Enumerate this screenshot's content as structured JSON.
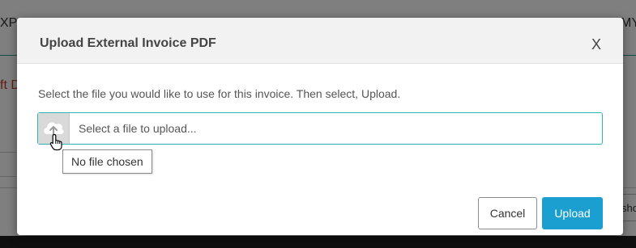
{
  "background": {
    "left_top_text": "XPI",
    "right_top_text": "MY",
    "left_red_text": "ft D",
    "right_button_text": "sho"
  },
  "modal": {
    "title": "Upload External Invoice PDF",
    "close_label": "X",
    "instruction": "Select the file you would like to use for this invoice. Then select, Upload.",
    "file_input": {
      "placeholder": "Select a file to upload...",
      "icon": "cloud-upload-icon"
    },
    "tooltip": "No file chosen",
    "buttons": {
      "cancel_label": "Cancel",
      "upload_label": "Upload"
    }
  },
  "colors": {
    "primary_button": "#1a9fd0",
    "input_border": "#2bb5b3"
  }
}
